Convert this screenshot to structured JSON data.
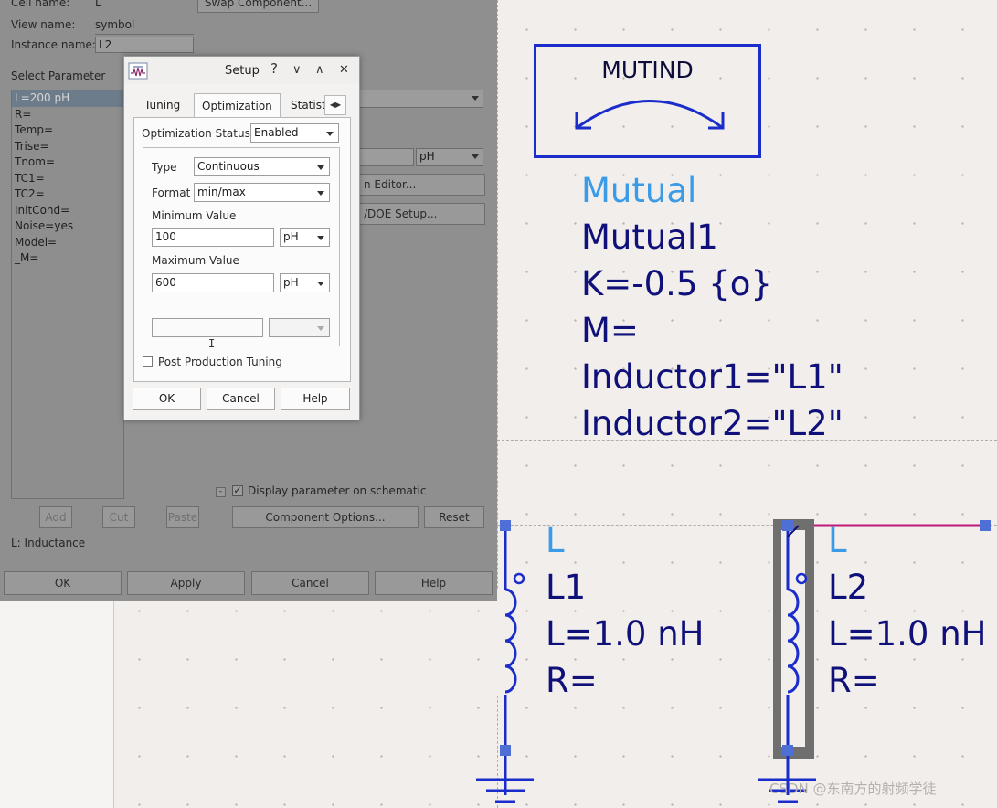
{
  "properties_dialog": {
    "cell_name_label": "Cell name:",
    "cell_name_value": "L",
    "view_name_label": "View name:",
    "view_name_value": "symbol",
    "instance_name_label": "Instance name:",
    "instance_name_value": "L2",
    "swap_component_label": "Swap Component...",
    "select_parameter_label": "Select Parameter",
    "parameters": [
      {
        "label": "L=200 pH",
        "selected": true
      },
      {
        "label": "R="
      },
      {
        "label": "Temp="
      },
      {
        "label": "Trise="
      },
      {
        "label": "Tnom="
      },
      {
        "label": "TC1="
      },
      {
        "label": "TC2="
      },
      {
        "label": "InitCond="
      },
      {
        "label": "Noise=yes"
      },
      {
        "label": "Model="
      },
      {
        "label": "_M="
      }
    ],
    "unit_value": "pH",
    "editor_button_label": "n Editor...",
    "doe_button_label": "/DOE Setup...",
    "display_param_label": "Display parameter on schematic",
    "add_label": "Add",
    "cut_label": "Cut",
    "paste_label": "Paste",
    "component_options_label": "Component Options...",
    "reset_label": "Reset",
    "description": "L: Inductance",
    "ok_label": "OK",
    "apply_label": "Apply",
    "cancel_label": "Cancel",
    "help_label": "Help"
  },
  "setup_dialog": {
    "title": "Setup",
    "controls": {
      "help": "?",
      "minimize": "∨",
      "maximize": "∧",
      "close": "✕"
    },
    "tabs": [
      {
        "label": "Tuning",
        "active": false
      },
      {
        "label": "Optimization",
        "active": true
      },
      {
        "label": "Statist",
        "active": false
      }
    ],
    "optimization_status_label": "Optimization Status",
    "optimization_status_value": "Enabled",
    "type_label": "Type",
    "type_value": "Continuous",
    "format_label": "Format",
    "format_value": "min/max",
    "min_value_label": "Minimum Value",
    "min_value": "100",
    "min_unit": "pH",
    "max_value_label": "Maximum Value",
    "max_value": "600",
    "max_unit": "pH",
    "post_production_label": "Post Production Tuning",
    "ok_label": "OK",
    "cancel_label": "Cancel",
    "help_label": "Help"
  },
  "schematic": {
    "mutind_symbol_label": "MUTIND",
    "mutual": {
      "type": "Mutual",
      "name": "Mutual1",
      "k": "K=-0.5 {o}",
      "m": "M=",
      "inductor1": "Inductor1=\"L1\"",
      "inductor2": "Inductor2=\"L2\""
    },
    "inductor1": {
      "type": "L",
      "name": "L1",
      "value": "L=1.0 nH",
      "r": "R="
    },
    "inductor2": {
      "type": "L",
      "name": "L2",
      "value": "L=1.0 nH",
      "r": "R="
    }
  },
  "watermark": "CSDN @东南方的射频学徒",
  "colors": {
    "wire_blue": "#1a2cc9",
    "text_navy": "#10107a",
    "text_light_blue": "#3b9be6",
    "pin_blue": "#4d6fd6",
    "wire_magenta": "#c0197a",
    "selection_gray": "#6f6f6f"
  }
}
